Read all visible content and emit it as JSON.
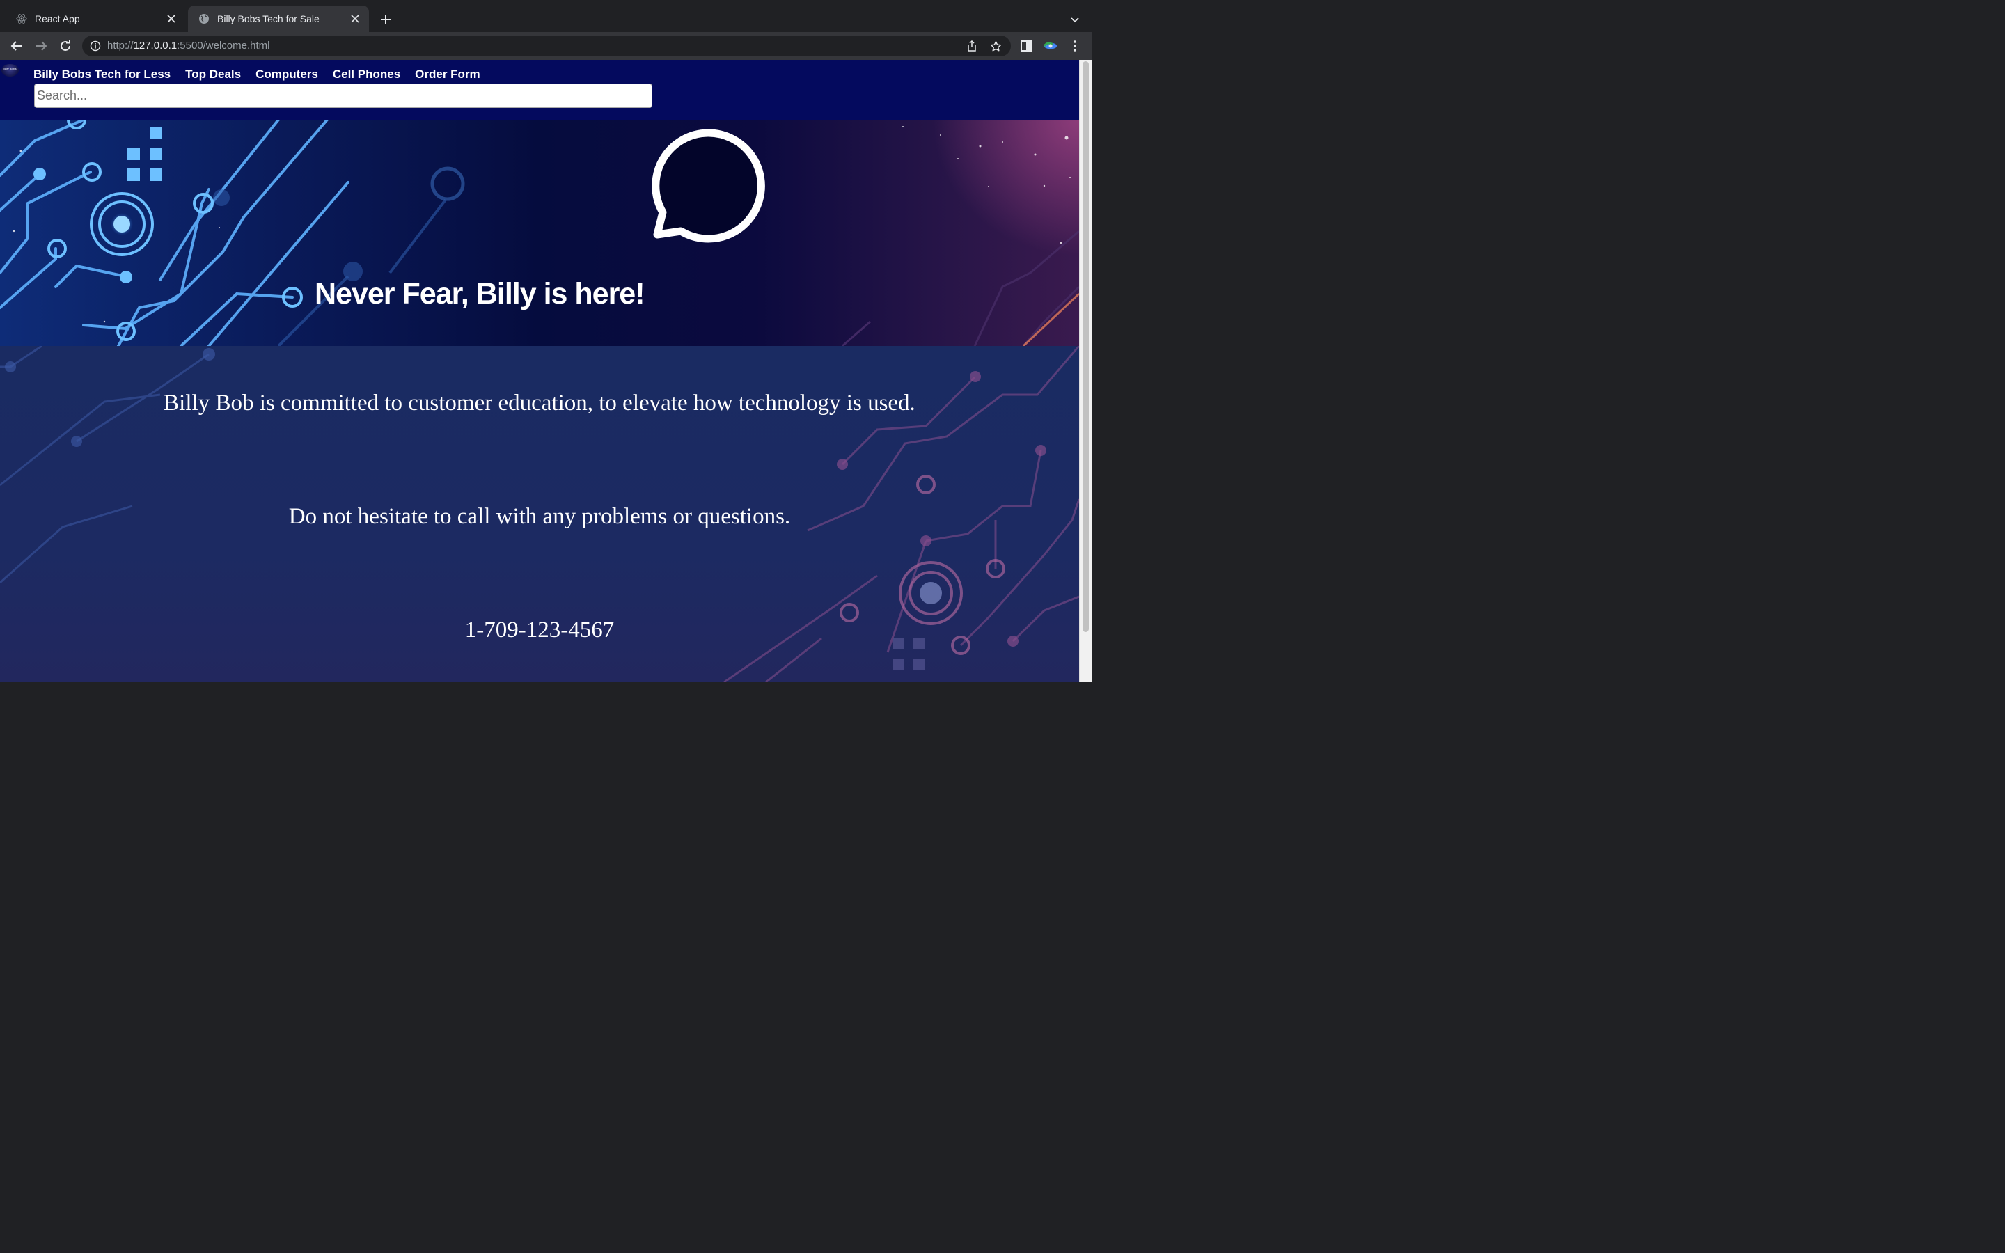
{
  "browser": {
    "tabs": [
      {
        "title": "React App",
        "favicon": "react-icon",
        "active": false
      },
      {
        "title": "Billy Bobs Tech for Sale",
        "favicon": "globe-icon",
        "active": true
      }
    ],
    "url_scheme": "http://",
    "url_host": "127.0.0.1",
    "url_rest": ":5500/welcome.html"
  },
  "site": {
    "logo_text": "Billy Bob's",
    "nav": [
      "Billy Bobs Tech for Less",
      "Top Deals",
      "Computers",
      "Cell Phones",
      "Order Form"
    ],
    "search_placeholder": "Search...",
    "hero_title": "Never Fear, Billy is here!",
    "paragraphs": [
      "Billy Bob is committed to customer education, to elevate how technology is used.",
      "Do not hesitate to call with any problems or questions.",
      "1-709-123-4567"
    ]
  },
  "colors": {
    "navbar_bg": "#040a5e",
    "chrome_bg": "#202124",
    "chrome_toolbar": "#35363a",
    "circuit_blue": "#5aaef5",
    "circuit_pink": "#d07a9a"
  }
}
